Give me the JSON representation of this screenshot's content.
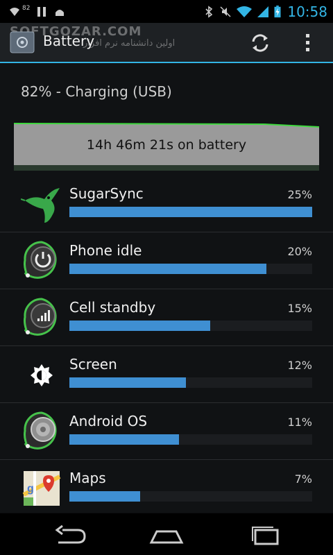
{
  "status_bar": {
    "notification_badge": "82",
    "time": "10:58"
  },
  "action_bar": {
    "title": "Battery",
    "watermark": "SOFTGOZAR.COM",
    "watermark_subtitle": "اولین دانشنامه نرم افزار"
  },
  "battery": {
    "status": "82% - Charging (USB)",
    "graph_label": "14h 46m 21s on battery"
  },
  "usage": [
    {
      "label": "SugarSync",
      "percent_label": "25%",
      "fill": 1.0,
      "icon": "hummingbird-icon"
    },
    {
      "label": "Phone idle",
      "percent_label": "20%",
      "fill": 0.81,
      "icon": "power-icon"
    },
    {
      "label": "Cell standby",
      "percent_label": "15%",
      "fill": 0.58,
      "icon": "signal-icon"
    },
    {
      "label": "Screen",
      "percent_label": "12%",
      "fill": 0.48,
      "icon": "brightness-icon"
    },
    {
      "label": "Android OS",
      "percent_label": "11%",
      "fill": 0.45,
      "icon": "android-os-icon"
    },
    {
      "label": "Maps",
      "percent_label": "7%",
      "fill": 0.29,
      "icon": "maps-icon"
    }
  ],
  "colors": {
    "accent": "#33b5e5",
    "bar": "#3f8fd2",
    "graph_bg": "#9a9a9a",
    "graph_line": "#3fd93f"
  }
}
